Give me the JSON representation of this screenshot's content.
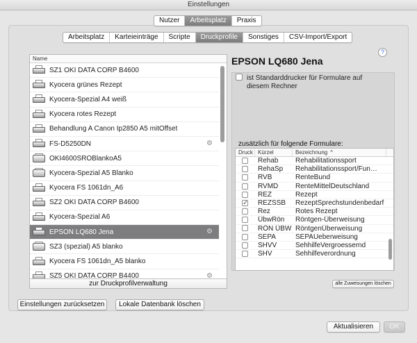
{
  "window": {
    "title": "Einstellungen"
  },
  "top_tabs": [
    {
      "label": "Nutzer",
      "active": false
    },
    {
      "label": "Arbeitsplatz",
      "active": true
    },
    {
      "label": "Praxis",
      "active": false
    }
  ],
  "sub_tabs": [
    {
      "label": "Arbeitsplatz",
      "active": false
    },
    {
      "label": "Karteieinträge",
      "active": false
    },
    {
      "label": "Scripte",
      "active": false
    },
    {
      "label": "Druckprofile",
      "active": true
    },
    {
      "label": "Sonstiges",
      "active": false
    },
    {
      "label": "CSV-Import/Export",
      "active": false
    }
  ],
  "printer_list": {
    "header": "Name",
    "items": [
      {
        "label": "SZ1 OKI DATA CORP B4600",
        "icon": "printer-icon",
        "selected": false,
        "gear": false
      },
      {
        "label": "Kyocera grünes Rezept",
        "icon": "printer-icon",
        "selected": false,
        "gear": false
      },
      {
        "label": "Kyocera-Spezial A4 weiß",
        "icon": "printer-icon",
        "selected": false,
        "gear": false
      },
      {
        "label": "Kyocera rotes Rezept",
        "icon": "printer-icon",
        "selected": false,
        "gear": false
      },
      {
        "label": "Behandlung A Canon Ip2850 A5 mitOffset",
        "icon": "printer-icon",
        "selected": false,
        "gear": false
      },
      {
        "label": "FS-D5250DN",
        "icon": "printer-icon",
        "selected": false,
        "gear": true
      },
      {
        "label": "OKI4600SROBlankoA5",
        "icon": "laser-printer-icon",
        "selected": false,
        "gear": false
      },
      {
        "label": "Kyocera-Spezial A5 Blanko",
        "icon": "laser-printer-icon",
        "selected": false,
        "gear": false
      },
      {
        "label": "Kyocera FS 1061dn_A6",
        "icon": "printer-icon",
        "selected": false,
        "gear": false
      },
      {
        "label": "SZ2 OKI DATA CORP B4600",
        "icon": "printer-icon",
        "selected": false,
        "gear": false
      },
      {
        "label": "Kyocera-Spezial A6",
        "icon": "printer-icon",
        "selected": false,
        "gear": false
      },
      {
        "label": "EPSON LQ680 Jena",
        "icon": "printer-icon",
        "selected": true,
        "gear": true
      },
      {
        "label": "SZ3 (spezial) A5 blanko",
        "icon": "laser-printer-icon",
        "selected": false,
        "gear": false
      },
      {
        "label": "Kyocera FS 1061dn_A5 blanko",
        "icon": "printer-icon",
        "selected": false,
        "gear": false
      },
      {
        "label": "SZ5 OKI DATA CORP B4400",
        "icon": "printer-icon",
        "selected": false,
        "gear": true
      }
    ],
    "footer_button": "zur Druckprofilverwaltung"
  },
  "detail": {
    "title": "EPSON LQ680 Jena",
    "help_label": "?",
    "default_printer_label": "ist Standarddrucker für Formulare auf diesem Rechner",
    "default_printer_checked": false,
    "forms_label": "zusätzlich für folgende Formulare:",
    "table_headers": {
      "print": "Druck",
      "short": "Kürzel",
      "name": "Bezeichnung"
    },
    "sort_arrow": "^",
    "forms": [
      {
        "checked": false,
        "short": "Rehab",
        "name": "Rehabilitationssport"
      },
      {
        "checked": false,
        "short": "RehaSp",
        "name": "Rehabilitationssport/Fun…"
      },
      {
        "checked": false,
        "short": "RVB",
        "name": "RenteBund"
      },
      {
        "checked": false,
        "short": "RVMD",
        "name": "RenteMittelDeutschland"
      },
      {
        "checked": false,
        "short": "REZ",
        "name": "Rezept"
      },
      {
        "checked": true,
        "short": "REZSSB",
        "name": "RezeptSprechstundenbedarf"
      },
      {
        "checked": false,
        "short": "Rez",
        "name": "Rotes Rezept"
      },
      {
        "checked": false,
        "short": "ÜbwRön",
        "name": "Röntgen-Überweisung"
      },
      {
        "checked": false,
        "short": "RÖN ÜBW",
        "name": "RöntgenÜberweisung"
      },
      {
        "checked": false,
        "short": "SEPA",
        "name": "SEPAUeberweisung"
      },
      {
        "checked": false,
        "short": "SHVV",
        "name": "SehhilfeVergroessernd"
      },
      {
        "checked": false,
        "short": "SHV",
        "name": "Sehhilfeverordnung"
      }
    ],
    "clear_assignments_button": "alle Zuweisungen löschen"
  },
  "bottom": {
    "reset_button": "Einstellungen zurücksetzen",
    "delete_db_button": "Lokale Datenbank löschen",
    "refresh_button": "Aktualisieren",
    "ok_button": "OK"
  },
  "colors": {
    "selected_row": "#7d7d80",
    "active_tab": "#8c8c8c",
    "help_accent": "#3a6fd8"
  }
}
